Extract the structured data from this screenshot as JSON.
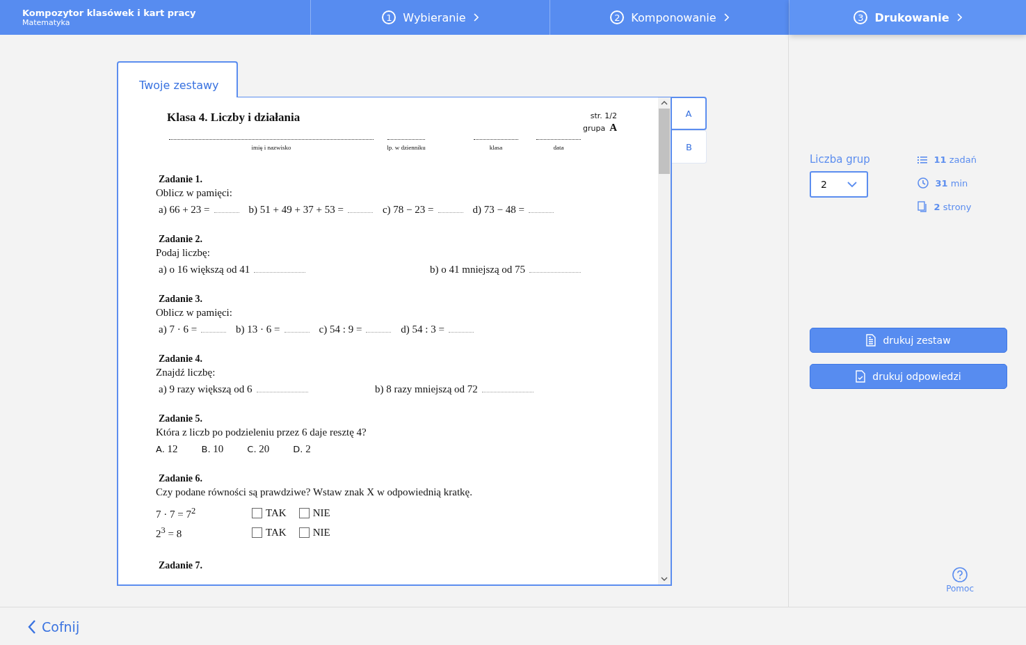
{
  "header": {
    "title": "Kompozytor klasówek i kart pracy",
    "subtitle": "Matematyka",
    "steps": [
      {
        "number": "1",
        "label": "Wybieranie",
        "selected": false
      },
      {
        "number": "2",
        "label": "Komponowanie",
        "selected": false
      },
      {
        "number": "3",
        "label": "Drukowanie",
        "selected": true
      }
    ]
  },
  "sets_tab": {
    "label": "Twoje zestawy",
    "selected": true
  },
  "worksheet": {
    "title": "Klasa 4. Liczby i działania",
    "page": "str. 1/2",
    "group_label": "grupa",
    "group": "A",
    "fields": [
      "imię i nazwisko",
      "lp. w dzienniku",
      "klasa",
      "data"
    ],
    "tasks": [
      {
        "heading": "Zadanie 1.",
        "prompt": "Oblicz w pamięci:",
        "kind": "blanks",
        "items": [
          "a) 66 + 23 =",
          "b) 51 + 49 + 37 + 53 =",
          "c) 78 − 23 =",
          "d) 73 − 48 ="
        ]
      },
      {
        "heading": "Zadanie 2.",
        "prompt": "Podaj liczbę:",
        "kind": "blanks",
        "items": [
          "a) o 16 większą od 41",
          "b) o 41 mniejszą od 75"
        ]
      },
      {
        "heading": "Zadanie 3.",
        "prompt": "Oblicz w pamięci:",
        "kind": "blanks",
        "items": [
          "a) 7 · 6 =",
          "b) 13 · 6 =",
          "c) 54 : 9 =",
          "d) 54 : 3 ="
        ]
      },
      {
        "heading": "Zadanie 4.",
        "prompt": "Znajdź liczbę:",
        "kind": "blanks",
        "items": [
          "a) 9 razy większą od 6",
          "b) 8 razy mniejszą od 72"
        ]
      },
      {
        "heading": "Zadanie 5.",
        "prompt": "Która z liczb po podzieleniu przez 6 daje resztę 4?",
        "kind": "choices",
        "choices": [
          {
            "letter": "A.",
            "value": "12"
          },
          {
            "letter": "B.",
            "value": "10"
          },
          {
            "letter": "C.",
            "value": "20"
          },
          {
            "letter": "D.",
            "value": "2"
          }
        ]
      },
      {
        "heading": "Zadanie 6.",
        "prompt": "Czy podane równości są prawdziwe? Wstaw znak X w odpowiednią kratkę.",
        "kind": "truefalse",
        "rows": [
          {
            "expression": "7 · 7 = 7$^{2}$",
            "options": [
              {
                "label": "TAK",
                "checked": false
              },
              {
                "label": "NIE",
                "checked": false
              }
            ]
          },
          {
            "expression": "2$^{3}$ = 8",
            "options": [
              {
                "label": "TAK",
                "checked": false
              },
              {
                "label": "NIE",
                "checked": false
              }
            ]
          }
        ]
      },
      {
        "heading": "Zadanie 7.",
        "kind": "cut"
      }
    ]
  },
  "group_tabs": [
    {
      "label": "A",
      "selected": true
    },
    {
      "label": "B",
      "selected": false
    }
  ],
  "settings": {
    "groups_label": "Liczba grup",
    "groups_value": "2",
    "stats": [
      {
        "kind": "tasks",
        "value": "11",
        "unit": "zadań"
      },
      {
        "kind": "time",
        "value": "31",
        "unit": "min"
      },
      {
        "kind": "pages",
        "value": "2",
        "unit": "strony"
      }
    ],
    "buttons": [
      {
        "kind": "print",
        "label": "drukuj zestaw"
      },
      {
        "kind": "answers",
        "label": "drukuj odpowiedzi"
      }
    ],
    "help": "Pomoc"
  },
  "footer": {
    "back": "Cofnij"
  }
}
